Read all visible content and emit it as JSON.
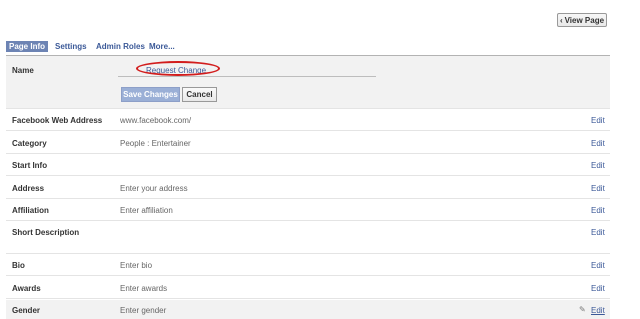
{
  "header": {
    "view_page_label": "View Page"
  },
  "tabs": [
    {
      "label": "Page Info",
      "active": true
    },
    {
      "label": "Settings",
      "active": false
    },
    {
      "label": "Admin Roles",
      "active": false
    },
    {
      "label": "More...",
      "active": false
    }
  ],
  "name_row": {
    "label": "Name",
    "request_change_label": "Request Change",
    "save_label": "Save Changes",
    "cancel_label": "Cancel"
  },
  "rows": [
    {
      "label": "Facebook Web Address",
      "value": "www.facebook.com/",
      "edit": "Edit"
    },
    {
      "label": "Category",
      "value": "People : Entertainer",
      "edit": "Edit"
    },
    {
      "label": "Start Info",
      "value": "",
      "edit": "Edit"
    },
    {
      "label": "Address",
      "value": "Enter your address",
      "edit": "Edit"
    },
    {
      "label": "Affiliation",
      "value": "Enter affiliation",
      "edit": "Edit"
    },
    {
      "label": "Short Description",
      "value": "",
      "edit": "Edit"
    },
    {
      "label": "Bio",
      "value": "Enter bio",
      "edit": "Edit"
    },
    {
      "label": "Awards",
      "value": "Enter awards",
      "edit": "Edit"
    },
    {
      "label": "Gender",
      "value": "Enter gender",
      "edit": "Edit"
    }
  ],
  "colors": {
    "link": "#3b5998",
    "annotation_oval": "#d21c1c",
    "active_tab": "#6d84b4"
  }
}
